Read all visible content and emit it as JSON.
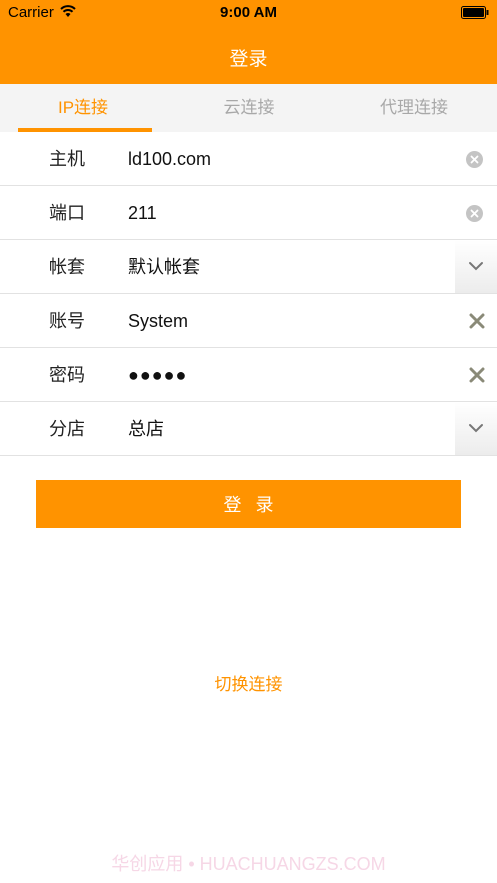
{
  "status_bar": {
    "carrier": "Carrier",
    "time": "9:00 AM"
  },
  "nav": {
    "title": "登录"
  },
  "tabs": [
    {
      "label": "IP连接",
      "active": true
    },
    {
      "label": "云连接",
      "active": false
    },
    {
      "label": "代理连接",
      "active": false
    }
  ],
  "form": {
    "host": {
      "label": "主机",
      "value": "ld100.com"
    },
    "port": {
      "label": "端口",
      "value": "211"
    },
    "account_set": {
      "label": "帐套",
      "value": "默认帐套"
    },
    "username": {
      "label": "账号",
      "value": "System"
    },
    "password": {
      "label": "密码",
      "value": "●●●●●"
    },
    "branch": {
      "label": "分店",
      "value": "总店"
    }
  },
  "login_button": "登录",
  "switch_link": "切换连接",
  "watermark": "华创应用 • HUACHUANGZS.COM",
  "colors": {
    "accent": "#ff9300",
    "tab_inactive": "#a8a8a8",
    "divider": "#e2e2e2"
  }
}
